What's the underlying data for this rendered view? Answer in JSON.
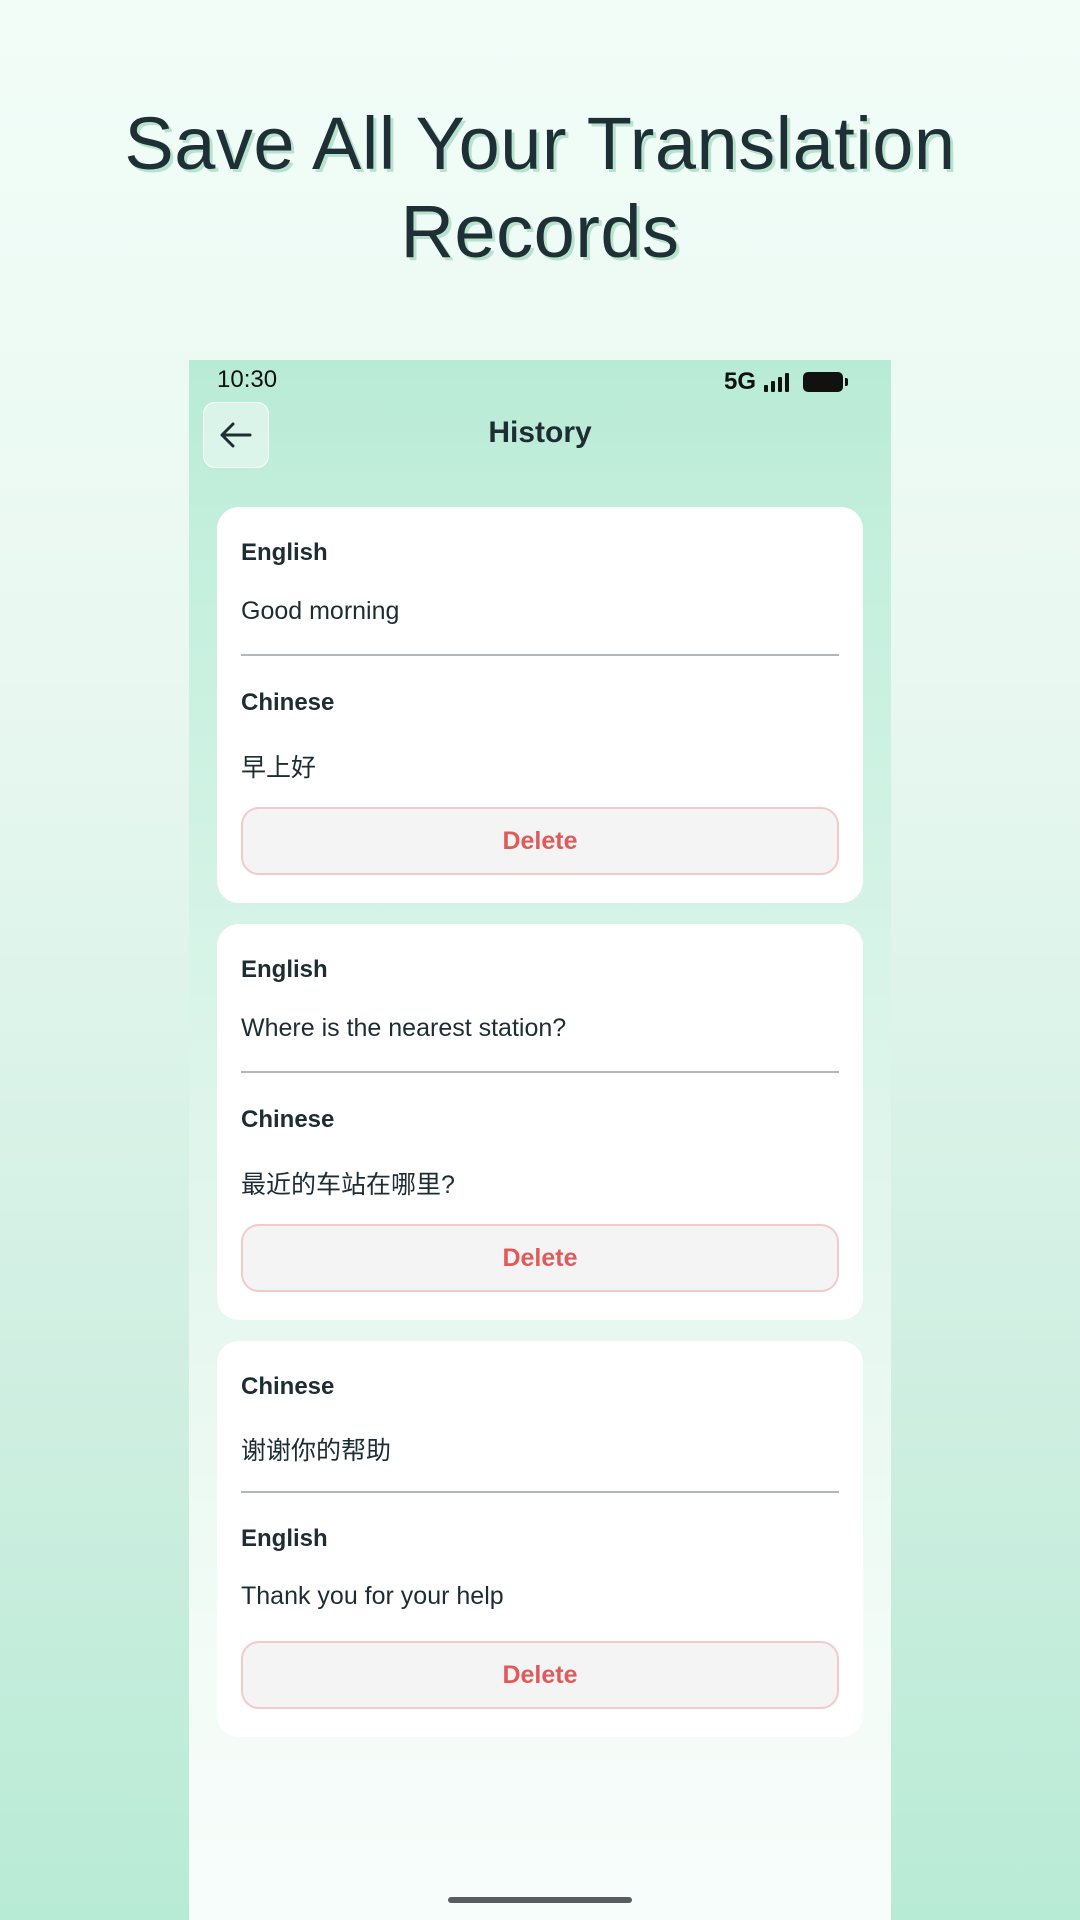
{
  "promo": {
    "title_line1": "Save All Your Translation",
    "title_line2": "Records"
  },
  "status_bar": {
    "time": "10:30",
    "network": "5G"
  },
  "header": {
    "title": "History",
    "back_icon": "arrow-left-icon"
  },
  "history": [
    {
      "source_label": "English",
      "source_text": "Good morning",
      "target_label": "Chinese",
      "target_text": "早上好",
      "delete_label": "Delete"
    },
    {
      "source_label": "English",
      "source_text": "Where is the nearest station?",
      "target_label": "Chinese",
      "target_text": "最近的车站在哪里?",
      "delete_label": "Delete"
    },
    {
      "source_label": "Chinese",
      "source_text": "谢谢你的帮助",
      "target_label": "English",
      "target_text": "Thank you for your help",
      "delete_label": "Delete"
    }
  ],
  "colors": {
    "accent_mint": "#b8ebd6",
    "delete_red": "#e05a5a",
    "text_dark": "#1d2d33"
  }
}
